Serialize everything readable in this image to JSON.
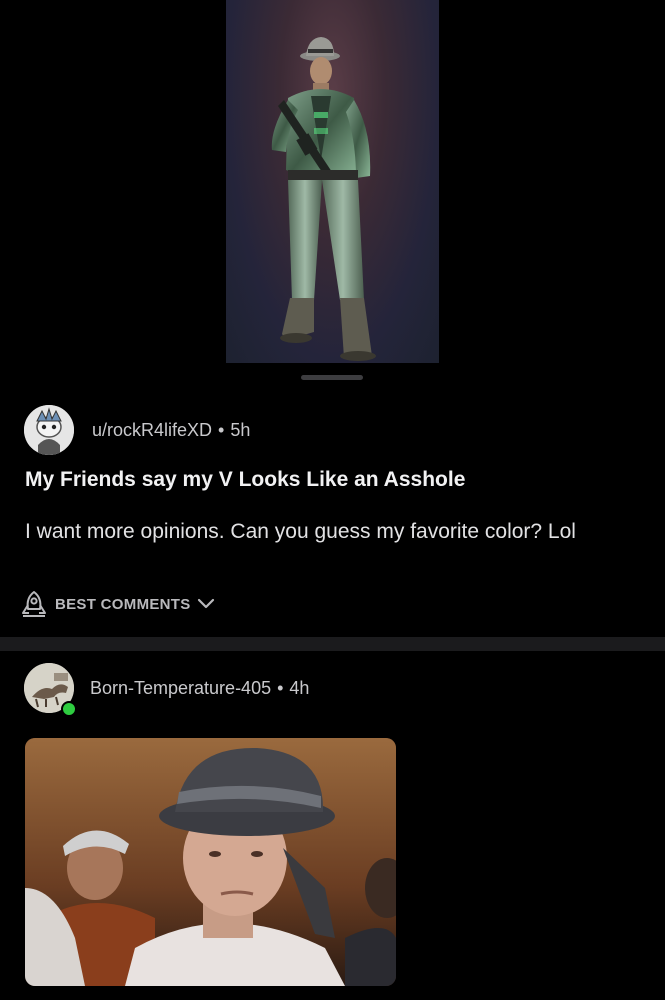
{
  "post": {
    "image_alt": "Cyberpunk V character in green metallic jacket holding rifle",
    "author": "u/rockR4lifeXD",
    "separator": "•",
    "age": "5h",
    "title": "My Friends say my V Looks Like an Asshole",
    "body": "I want more opinions. Can you guess my favorite color? Lol"
  },
  "comments_sort": {
    "label": "BEST COMMENTS",
    "icon": "rocket-icon",
    "chevron": "chevron-down-icon"
  },
  "comment": {
    "author": "Born-Temperature-405",
    "separator": "•",
    "age": "4h",
    "online": true,
    "image_alt": "Man in fedora hat with blank expression"
  },
  "colors": {
    "background": "#000000",
    "online": "#2ecc40",
    "divider": "#1b1b1d"
  }
}
